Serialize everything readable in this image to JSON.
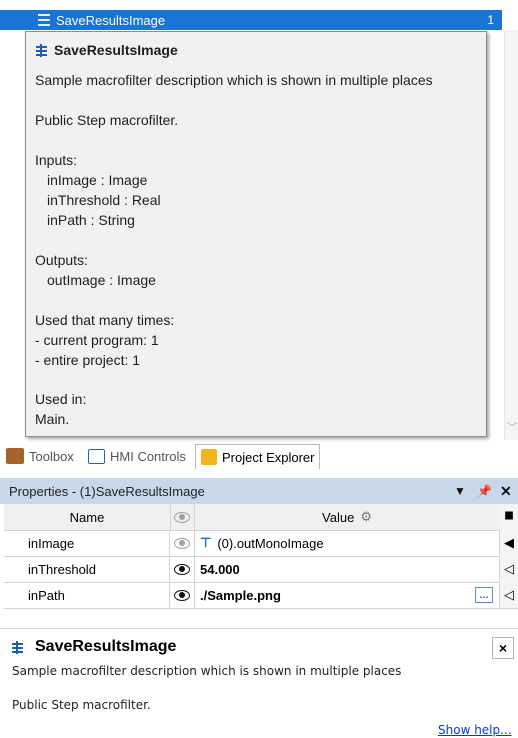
{
  "list": {
    "selected_item": "SaveResultsImage",
    "count": "1"
  },
  "tooltip": {
    "title": "SaveResultsImage",
    "description": "Sample macrofilter description which is shown in multiple places",
    "kind": "Public Step macrofilter.",
    "inputs_label": "Inputs:",
    "inputs": [
      "inImage : Image",
      "inThreshold : Real",
      "inPath : String"
    ],
    "outputs_label": "Outputs:",
    "outputs": [
      "outImage : Image"
    ],
    "usage_label": "Used that many times:",
    "usage": [
      "- current program: 1",
      "- entire project: 1"
    ],
    "used_in_label": "Used in:",
    "used_in": "Main."
  },
  "tabs": [
    {
      "label": "Toolbox",
      "icon": "toolbox-icon"
    },
    {
      "label": "HMI Controls",
      "icon": "hmi-icon"
    },
    {
      "label": "Project Explorer",
      "icon": "project-explorer-icon"
    }
  ],
  "properties": {
    "title": "Properties - (1)SaveResultsImage",
    "columns": {
      "name": "Name",
      "value": "Value"
    },
    "rows": [
      {
        "name": "inImage",
        "value": "(0).outMonoImage",
        "bold": false,
        "eye": "gray"
      },
      {
        "name": "inThreshold",
        "value": "54.000",
        "bold": true,
        "eye": "black"
      },
      {
        "name": "inPath",
        "value": "./Sample.png",
        "bold": true,
        "eye": "black"
      }
    ]
  },
  "help": {
    "title": "SaveResultsImage",
    "description": "Sample macrofilter description which is shown in multiple places",
    "kind": "Public Step macrofilter.",
    "close": "×",
    "show_help": "Show help..."
  },
  "colors": {
    "selection": "#1a74d6",
    "header_bg": "#c8d8ea",
    "tooltip_bg": "#f1f1f1"
  }
}
